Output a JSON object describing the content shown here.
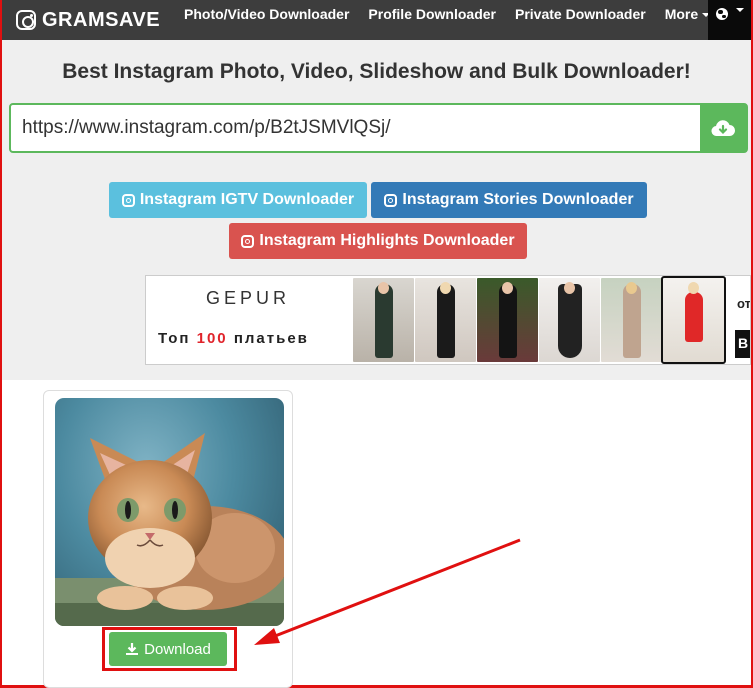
{
  "navbar": {
    "brand": "GRAMSAVE",
    "links": [
      "Photo/Video Downloader",
      "Profile Downloader",
      "Private Downloader",
      "More"
    ],
    "language_icon": "globe-icon"
  },
  "hero": {
    "title": "Best Instagram Photo, Video, Slideshow and Bulk Downloader!",
    "url_value": "https://www.instagram.com/p/B2tJSMVlQSj/",
    "submit_icon": "cloud-download-icon"
  },
  "buttons": {
    "igtv": "Instagram IGTV Downloader",
    "stories": "Instagram Stories Downloader",
    "highlights": "Instagram Highlights Downloader"
  },
  "ad": {
    "brand": "GEPUR",
    "tagline_prefix": "Топ",
    "tagline_number": "100",
    "tagline_suffix": "платьев",
    "cut_text": "от",
    "cut_button": "В"
  },
  "result": {
    "download_label": "Download",
    "download_icon": "download-icon"
  },
  "colors": {
    "success": "#5cb85c",
    "info": "#5bc0de",
    "primary": "#337ab7",
    "danger": "#d9534f",
    "annotation": "#e01010"
  }
}
